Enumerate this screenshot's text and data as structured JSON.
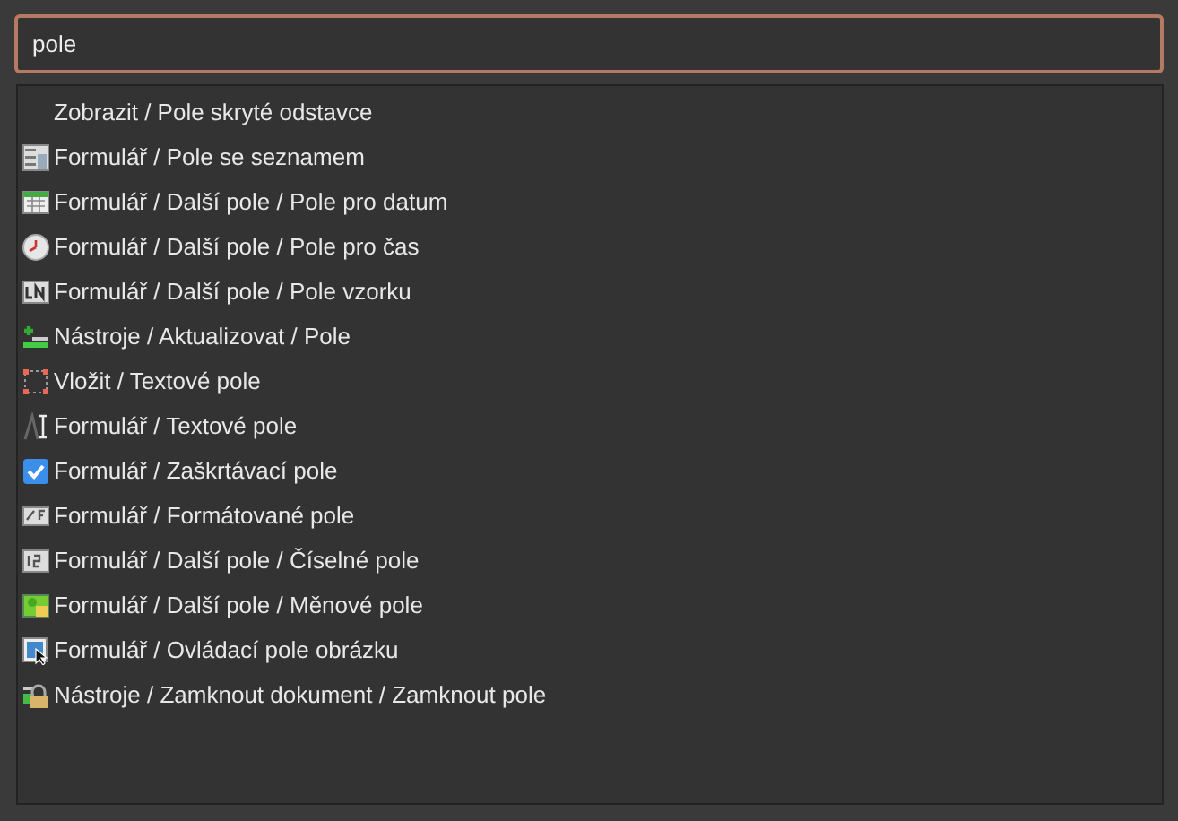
{
  "search": {
    "value": "pole"
  },
  "results": [
    {
      "label": "Zobrazit / Pole skryté odstavce",
      "kind": "none"
    },
    {
      "label": "Formulář / Pole se seznamem",
      "kind": "listbox"
    },
    {
      "label": "Formulář / Další pole / Pole pro datum",
      "kind": "calendar"
    },
    {
      "label": "Formulář / Další pole / Pole pro čas",
      "kind": "clock"
    },
    {
      "label": "Formulář / Další pole / Pole vzorku",
      "kind": "pattern"
    },
    {
      "label": "Nástroje / Aktualizovat / Pole",
      "kind": "update"
    },
    {
      "label": "Vložit / Textové pole",
      "kind": "textframe"
    },
    {
      "label": "Formulář / Textové pole",
      "kind": "textcursor"
    },
    {
      "label": "Formulář / Zaškrtávací pole",
      "kind": "checkbox"
    },
    {
      "label": "Formulář / Formátované pole",
      "kind": "formatted"
    },
    {
      "label": "Formulář / Další pole / Číselné pole",
      "kind": "numeric"
    },
    {
      "label": "Formulář / Další pole / Měnové pole",
      "kind": "currency"
    },
    {
      "label": "Formulář / Ovládací pole obrázku",
      "kind": "imagebutton"
    },
    {
      "label": "Nástroje / Zamknout dokument / Zamknout pole",
      "kind": "lock"
    }
  ]
}
